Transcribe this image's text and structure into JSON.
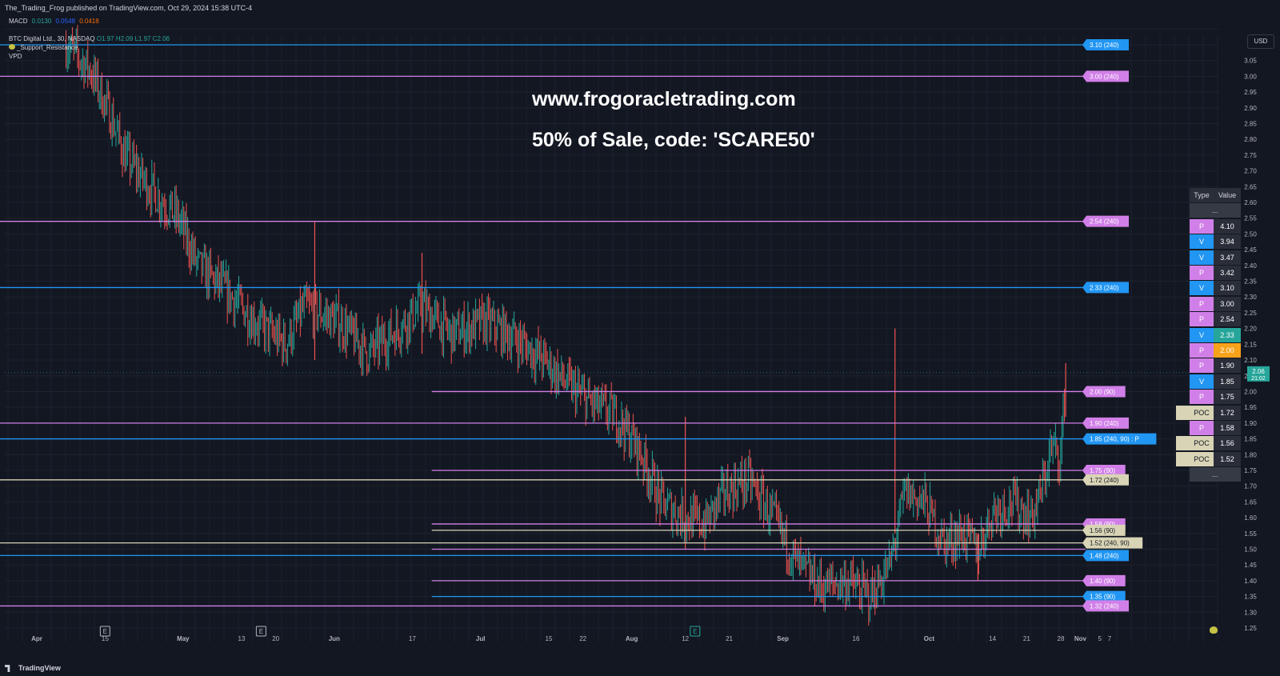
{
  "header": {
    "published": "The_Trading_Frog published on TradingView.com, Oct 29, 2024 15:38 UTC-4"
  },
  "indicators": {
    "macd": {
      "label": "MACD",
      "v1": "0.0130",
      "v2": "0.0548",
      "v3": "0.0418",
      "c1": "#26a69a",
      "c2": "#2962ff",
      "c3": "#ff6d00"
    },
    "symbol": {
      "label": "BTC Digital Ltd., 30, NASDAQ",
      "o": "O1.97",
      "h": "H2.09",
      "l": "L1.97",
      "c": "C2.06"
    },
    "support_resistance": "_Support_Resistance",
    "vpd": "VPD"
  },
  "promo": {
    "line1": "www.frogoracletrading.com",
    "line2": "50% of Sale, code: 'SCARE50'"
  },
  "currency_button": "USD",
  "footer": {
    "brand": "TradingView"
  },
  "colors": {
    "background": "#131722",
    "grid": "#1e222d",
    "up": "#26a69a",
    "down": "#ef5350",
    "level_p": "#d17fe8",
    "level_v": "#2196f3",
    "level_poc": "#d8d4b5",
    "price_tag": "#26a69a",
    "highlight": "#f7a21b"
  },
  "sr_table": {
    "headers": [
      "Type",
      "Value"
    ],
    "ellipsis": "...",
    "rows": [
      {
        "type": "P",
        "value": "4.10"
      },
      {
        "type": "V",
        "value": "3.94"
      },
      {
        "type": "V",
        "value": "3.47"
      },
      {
        "type": "P",
        "value": "3.42"
      },
      {
        "type": "V",
        "value": "3.10"
      },
      {
        "type": "P",
        "value": "3.00"
      },
      {
        "type": "P",
        "value": "2.54"
      },
      {
        "type": "V",
        "value": "2.33",
        "highlight": "teal"
      },
      {
        "type": "P",
        "value": "2.00",
        "highlight": "orange"
      },
      {
        "type": "P",
        "value": "1.90"
      },
      {
        "type": "V",
        "value": "1.85"
      },
      {
        "type": "P",
        "value": "1.75"
      },
      {
        "type": "POC",
        "value": "1.72"
      },
      {
        "type": "P",
        "value": "1.58"
      },
      {
        "type": "POC",
        "value": "1.56"
      },
      {
        "type": "POC",
        "value": "1.52"
      }
    ]
  },
  "chart_data": {
    "type": "candlestick",
    "symbol": "BTC Digital Ltd., 30, NASDAQ",
    "ylim": [
      1.25,
      3.15
    ],
    "y_ticks": [
      "1.25",
      "1.30",
      "1.35",
      "1.40",
      "1.45",
      "1.50",
      "1.55",
      "1.60",
      "1.65",
      "1.70",
      "1.75",
      "1.80",
      "1.85",
      "1.90",
      "1.95",
      "2.00",
      "2.05",
      "2.10",
      "2.15",
      "2.20",
      "2.25",
      "2.30",
      "2.35",
      "2.40",
      "2.45",
      "2.50",
      "2.55",
      "2.60",
      "2.65",
      "2.70",
      "2.75",
      "2.80",
      "2.85",
      "2.90",
      "2.95",
      "3.00",
      "3.05"
    ],
    "x_ticks": [
      {
        "label": "Apr",
        "date": "2024-04-01",
        "bold": true
      },
      {
        "label": "15",
        "date": "2024-04-15"
      },
      {
        "label": "May",
        "date": "2024-05-01",
        "bold": true
      },
      {
        "label": "13",
        "date": "2024-05-13"
      },
      {
        "label": "20",
        "date": "2024-05-20"
      },
      {
        "label": "Jun",
        "date": "2024-06-01",
        "bold": true
      },
      {
        "label": "17",
        "date": "2024-06-17"
      },
      {
        "label": "Jul",
        "date": "2024-07-01",
        "bold": true
      },
      {
        "label": "15",
        "date": "2024-07-15"
      },
      {
        "label": "22",
        "date": "2024-07-22"
      },
      {
        "label": "Aug",
        "date": "2024-08-01",
        "bold": true
      },
      {
        "label": "12",
        "date": "2024-08-12"
      },
      {
        "label": "21",
        "date": "2024-08-21"
      },
      {
        "label": "Sep",
        "date": "2024-09-01",
        "bold": true
      },
      {
        "label": "16",
        "date": "2024-09-16"
      },
      {
        "label": "Oct",
        "date": "2024-10-01",
        "bold": true
      },
      {
        "label": "14",
        "date": "2024-10-14"
      },
      {
        "label": "21",
        "date": "2024-10-21"
      },
      {
        "label": "28",
        "date": "2024-10-28"
      },
      {
        "label": "Nov",
        "date": "2024-11-01",
        "bold": true
      },
      {
        "label": "5",
        "date": "2024-11-05"
      },
      {
        "label": "7",
        "date": "2024-11-07"
      }
    ],
    "x_range": [
      "2024-03-22",
      "2024-11-10"
    ],
    "last_price": {
      "value": 2.06,
      "label": "2.06",
      "countdown": "21:02"
    },
    "price_path": [
      [
        "2024-04-07",
        3.1
      ],
      [
        "2024-04-12",
        3.02
      ],
      [
        "2024-04-16",
        2.88
      ],
      [
        "2024-04-19",
        2.75
      ],
      [
        "2024-04-24",
        2.65
      ],
      [
        "2024-04-30",
        2.55
      ],
      [
        "2024-05-04",
        2.4
      ],
      [
        "2024-05-09",
        2.33
      ],
      [
        "2024-05-16",
        2.22
      ],
      [
        "2024-05-22",
        2.15
      ],
      [
        "2024-05-26",
        2.27
      ],
      [
        "2024-06-02",
        2.22
      ],
      [
        "2024-06-08",
        2.12
      ],
      [
        "2024-06-14",
        2.2
      ],
      [
        "2024-06-19",
        2.27
      ],
      [
        "2024-06-25",
        2.18
      ],
      [
        "2024-07-02",
        2.22
      ],
      [
        "2024-07-08",
        2.17
      ],
      [
        "2024-07-14",
        2.1
      ],
      [
        "2024-07-19",
        2.02
      ],
      [
        "2024-07-24",
        1.96
      ],
      [
        "2024-07-29",
        1.92
      ],
      [
        "2024-08-03",
        1.8
      ],
      [
        "2024-08-07",
        1.65
      ],
      [
        "2024-08-12",
        1.6
      ],
      [
        "2024-08-16",
        1.58
      ],
      [
        "2024-08-20",
        1.68
      ],
      [
        "2024-08-25",
        1.72
      ],
      [
        "2024-08-30",
        1.6
      ],
      [
        "2024-09-04",
        1.45
      ],
      [
        "2024-09-09",
        1.38
      ],
      [
        "2024-09-14",
        1.4
      ],
      [
        "2024-09-19",
        1.35
      ],
      [
        "2024-09-23",
        1.45
      ],
      [
        "2024-09-26",
        1.68
      ],
      [
        "2024-09-30",
        1.65
      ],
      [
        "2024-10-04",
        1.52
      ],
      [
        "2024-10-08",
        1.55
      ],
      [
        "2024-10-11",
        1.5
      ],
      [
        "2024-10-14",
        1.62
      ],
      [
        "2024-10-18",
        1.65
      ],
      [
        "2024-10-22",
        1.6
      ],
      [
        "2024-10-24",
        1.68
      ],
      [
        "2024-10-26",
        1.82
      ],
      [
        "2024-10-28",
        1.8
      ],
      [
        "2024-10-29",
        2.06
      ]
    ],
    "spikes": [
      {
        "date": "2024-05-28",
        "high": 2.54,
        "low": 2.1
      },
      {
        "date": "2024-06-19",
        "high": 2.44,
        "low": 2.12
      },
      {
        "date": "2024-08-12",
        "high": 1.92,
        "low": 1.5
      },
      {
        "date": "2024-09-24",
        "high": 2.2,
        "low": 1.55
      },
      {
        "date": "2024-10-11",
        "high": 1.55,
        "low": 1.4
      },
      {
        "date": "2024-10-29",
        "high": 2.09,
        "low": 1.92
      }
    ],
    "levels": [
      {
        "value": 3.1,
        "label": "3.10 (240)",
        "kind": "V",
        "start": "2024-03-22"
      },
      {
        "value": 3.0,
        "label": "3.00 (240)",
        "kind": "P",
        "start": "2024-03-22"
      },
      {
        "value": 2.54,
        "label": "2.54 (240)",
        "kind": "P",
        "start": "2024-03-22"
      },
      {
        "value": 2.33,
        "label": "2.33 (240)",
        "kind": "V",
        "start": "2024-03-22"
      },
      {
        "value": 2.0,
        "label": "2.00 (90)",
        "kind": "P",
        "start": "2024-06-21"
      },
      {
        "value": 1.9,
        "label": "1.90 (240)",
        "kind": "P",
        "start": "2024-03-22"
      },
      {
        "value": 1.85,
        "label": "1.85 (240, 90) : P",
        "kind": "V",
        "start": "2024-03-22"
      },
      {
        "value": 1.75,
        "label": "1.75 (90)",
        "kind": "P",
        "start": "2024-06-21"
      },
      {
        "value": 1.72,
        "label": "1.72 (240)",
        "kind": "POC",
        "start": "2024-03-22"
      },
      {
        "value": 1.58,
        "label": "1.58 (90)",
        "kind": "P",
        "start": "2024-06-21"
      },
      {
        "value": 1.56,
        "label": "1.56 (90)",
        "kind": "POC",
        "start": "2024-06-21"
      },
      {
        "value": 1.52,
        "label": "1.52 (240, 90)",
        "kind": "POC",
        "start": "2024-03-22"
      },
      {
        "value": 1.5,
        "label": "",
        "kind": "P",
        "start": "2024-06-21"
      },
      {
        "value": 1.48,
        "label": "1.48 (240)",
        "kind": "V",
        "start": "2024-03-22"
      },
      {
        "value": 1.4,
        "label": "1.40 (90)",
        "kind": "P",
        "start": "2024-06-21"
      },
      {
        "value": 1.35,
        "label": "1.35 (90)",
        "kind": "V",
        "start": "2024-06-21"
      },
      {
        "value": 1.32,
        "label": "1.32 (240)",
        "kind": "P",
        "start": "2024-03-22"
      }
    ],
    "event_markers": [
      {
        "date": "2024-04-15",
        "label": "E"
      },
      {
        "date": "2024-05-17",
        "label": "E"
      },
      {
        "date": "2024-08-14",
        "label": "E",
        "active": true
      }
    ]
  }
}
